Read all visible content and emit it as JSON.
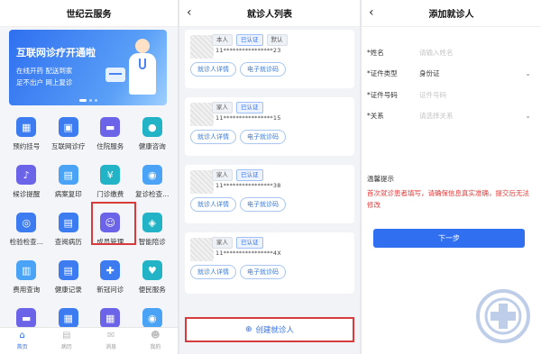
{
  "panel1": {
    "title": "世纪云服务",
    "banner": {
      "title": "互联网诊疗开通啦",
      "line1": "在线开药  配送到家",
      "line2": "足不出户  网上复诊"
    },
    "grid": [
      {
        "label": "预约挂号",
        "icon": "calendar-icon",
        "color": "blue",
        "glyph": "▦"
      },
      {
        "label": "互联网诊疗",
        "icon": "video-consult-icon",
        "color": "blue",
        "glyph": "▣"
      },
      {
        "label": "住院服务",
        "icon": "bed-icon",
        "color": "purple",
        "glyph": "▬"
      },
      {
        "label": "健康咨询",
        "icon": "chat-icon",
        "color": "teal",
        "glyph": "●"
      },
      {
        "label": "候诊提醒",
        "icon": "bell-icon",
        "color": "purple",
        "glyph": "♪"
      },
      {
        "label": "病案复印",
        "icon": "copy-icon",
        "color": "sky",
        "glyph": "▤"
      },
      {
        "label": "门诊缴费",
        "icon": "payment-icon",
        "color": "teal",
        "glyph": "¥"
      },
      {
        "label": "复诊检查...",
        "icon": "checkup-icon",
        "color": "sky",
        "glyph": "◉"
      },
      {
        "label": "检验检查...",
        "icon": "report-icon",
        "color": "blue",
        "glyph": "◎"
      },
      {
        "label": "查阅病历",
        "icon": "record-icon",
        "color": "blue",
        "glyph": "▤"
      },
      {
        "label": "成员管理",
        "icon": "member-icon",
        "color": "purple",
        "glyph": "☺"
      },
      {
        "label": "智能陪诊",
        "icon": "smart-guide-icon",
        "color": "teal",
        "glyph": "◈"
      },
      {
        "label": "费用查询",
        "icon": "fee-icon",
        "color": "sky",
        "glyph": "▥"
      },
      {
        "label": "健康记录",
        "icon": "health-record-icon",
        "color": "blue",
        "glyph": "▤"
      },
      {
        "label": "新冠问诊",
        "icon": "covid-icon",
        "color": "blue",
        "glyph": "✚"
      },
      {
        "label": "便民服务",
        "icon": "service-icon",
        "color": "teal",
        "glyph": "♥"
      },
      {
        "label": "床位预约",
        "icon": "bed-booking-icon",
        "color": "purple",
        "glyph": "▬"
      },
      {
        "label": "出院随访",
        "icon": "followup-icon",
        "color": "blue",
        "glyph": "▦"
      },
      {
        "label": "出院带药",
        "icon": "medicine-icon",
        "color": "purple",
        "glyph": "▦"
      },
      {
        "label": "心理测评",
        "icon": "mental-icon",
        "color": "sky",
        "glyph": "◉"
      }
    ],
    "tabs": [
      {
        "label": "首页",
        "icon": "home-icon",
        "glyph": "⌂",
        "active": true
      },
      {
        "label": "病历",
        "icon": "record-tab-icon",
        "glyph": "▤",
        "active": false
      },
      {
        "label": "消息",
        "icon": "message-icon",
        "glyph": "✉",
        "active": false
      },
      {
        "label": "我的",
        "icon": "profile-icon",
        "glyph": "☻",
        "active": false
      }
    ]
  },
  "panel2": {
    "title": "就诊人列表",
    "patients": [
      {
        "tags": [
          "本人",
          "已认证",
          "默认"
        ],
        "id": "11****************23",
        "detail_btn": "就诊人详情",
        "card_btn": "电子就诊码"
      },
      {
        "tags": [
          "家人",
          "已认证"
        ],
        "id": "11****************15",
        "detail_btn": "就诊人详情",
        "card_btn": "电子就诊码"
      },
      {
        "tags": [
          "家人",
          "已认证"
        ],
        "id": "11****************38",
        "detail_btn": "就诊人详情",
        "card_btn": "电子就诊码"
      },
      {
        "tags": [
          "家人",
          "已认证"
        ],
        "id": "11****************4X",
        "detail_btn": "就诊人详情",
        "card_btn": "电子就诊码"
      }
    ],
    "create_label": "创建就诊人"
  },
  "panel3": {
    "title": "添加就诊人",
    "fields": [
      {
        "label": "*姓名",
        "value": "请输入姓名",
        "placeholder": true,
        "dropdown": false
      },
      {
        "label": "*证件类型",
        "value": "身份证",
        "placeholder": false,
        "dropdown": true
      },
      {
        "label": "*证件号码",
        "value": "证件号码",
        "placeholder": true,
        "dropdown": false
      },
      {
        "label": "*关系",
        "value": "请选择关系",
        "placeholder": true,
        "dropdown": true
      }
    ],
    "notice_title": "温馨提示",
    "notice_text": "首次就诊患者填写，请确保信息真实准确，提交后无法修改",
    "next_label": "下一步"
  },
  "colors": {
    "accent": "#2f6ff0",
    "highlight": "#d83b3b",
    "warning": "#e23b3b"
  }
}
